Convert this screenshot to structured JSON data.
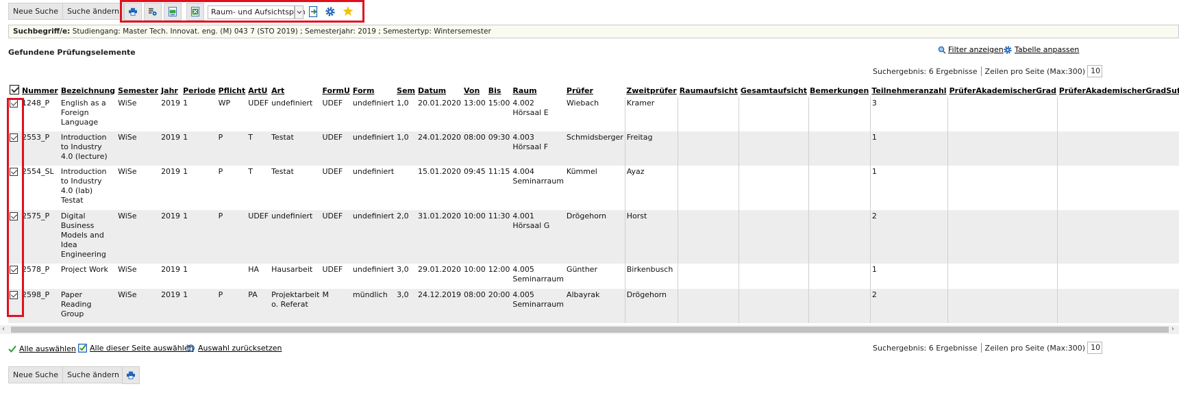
{
  "toolbar": {
    "new_search": "Neue Suche",
    "change_search": "Suche ändern",
    "print_icon": "printer-icon",
    "export_icon": "export-settings-icon",
    "csv_icon": "csv-export-icon",
    "xls_icon": "excel-export-icon",
    "plan_select_value": "Raum- und Aufsichtsplan",
    "go_icon": "export-go-icon",
    "settings_icon": "gear-icon",
    "favorite_icon": "star-icon"
  },
  "search_terms": {
    "label": "Suchbegriff/e:",
    "text": "Studiengang: Master Tech. Innovat. eng. (M) 043 7 (STO 2019) ;  Semesterjahr: 2019 ;  Semestertyp: Wintersemester"
  },
  "section_title": "Gefundene Prüfungselemente",
  "links": {
    "filter": "Filter anzeigen",
    "table_adjust": "Tabelle anpassen"
  },
  "result_info": {
    "count": "Suchergebnis: 6 Ergebnisse",
    "rows_label": "Zeilen pro Seite (Max:300)",
    "rows_value": "10"
  },
  "table": {
    "headers": [
      "Nummer",
      "Bezeichnung",
      "Semester",
      "Jahr",
      "Periode",
      "Pflicht",
      "ArtU",
      "Art",
      "FormU",
      "Form",
      "Sem",
      "Datum",
      "Von",
      "Bis",
      "Raum",
      "Prüfer",
      "Zweitprüfer",
      "Raumaufsicht",
      "Gesamtaufsicht",
      "Bemerkungen",
      "Teilnehmeranzahl",
      "PrüferAkademischerGrad",
      "PrüferAkademischerGradSuffix"
    ],
    "rows": [
      [
        "1248_P",
        "English as a Foreign Language",
        "WiSe",
        "2019",
        "1",
        "WP",
        "UDEF",
        "undefiniert",
        "UDEF",
        "undefiniert",
        "1,0",
        "20.01.2020",
        "13:00",
        "15:00",
        "4.002 Hörsaal E",
        "Wiebach",
        "Kramer",
        "",
        "",
        "",
        "3",
        "",
        ""
      ],
      [
        "2553_P",
        "Introduction to Industry 4.0 (lecture)",
        "WiSe",
        "2019",
        "1",
        "P",
        "T",
        "Testat",
        "UDEF",
        "undefiniert",
        "1,0",
        "24.01.2020",
        "08:00",
        "09:30",
        "4.003 Hörsaal F",
        "Schmidsberger",
        "Freitag",
        "",
        "",
        "",
        "1",
        "",
        ""
      ],
      [
        "2554_SL",
        "Introduction to Industry 4.0 (lab) Testat",
        "WiSe",
        "2019",
        "1",
        "P",
        "T",
        "Testat",
        "UDEF",
        "undefiniert",
        "",
        "15.01.2020",
        "09:45",
        "11:15",
        "4.004 Seminarraum",
        "Kümmel",
        "Ayaz",
        "",
        "",
        "",
        "1",
        "",
        ""
      ],
      [
        "2575_P",
        "Digital Business Models and Idea Engineering",
        "WiSe",
        "2019",
        "1",
        "P",
        "UDEF",
        "undefiniert",
        "UDEF",
        "undefiniert",
        "2,0",
        "31.01.2020",
        "10:00",
        "11:30",
        "4.001 Hörsaal G",
        "Drögehorn",
        "Horst",
        "",
        "",
        "",
        "2",
        "",
        ""
      ],
      [
        "2578_P",
        "Project Work",
        "WiSe",
        "2019",
        "1",
        "",
        "HA",
        "Hausarbeit",
        "UDEF",
        "undefiniert",
        "3,0",
        "29.01.2020",
        "10:00",
        "12:00",
        "4.005 Seminarraum",
        "Günther",
        "Birkenbusch",
        "",
        "",
        "",
        "1",
        "",
        ""
      ],
      [
        "2598_P",
        "Paper Reading Group",
        "WiSe",
        "2019",
        "1",
        "P",
        "PA",
        "Projektarbeit o. Referat",
        "M",
        "mündlich",
        "3,0",
        "24.12.2019",
        "08:00",
        "20:00",
        "4.005 Seminarraum",
        "Albayrak",
        "Drögehorn",
        "",
        "",
        "",
        "2",
        "",
        ""
      ]
    ]
  },
  "bottom_links": {
    "select_all": "Alle auswählen",
    "select_page": "Alle dieser Seite auswählen",
    "reset": "Auswahl zurücksetzen"
  },
  "footer": {
    "new_search": "Neue Suche",
    "change_search": "Suche ändern"
  }
}
